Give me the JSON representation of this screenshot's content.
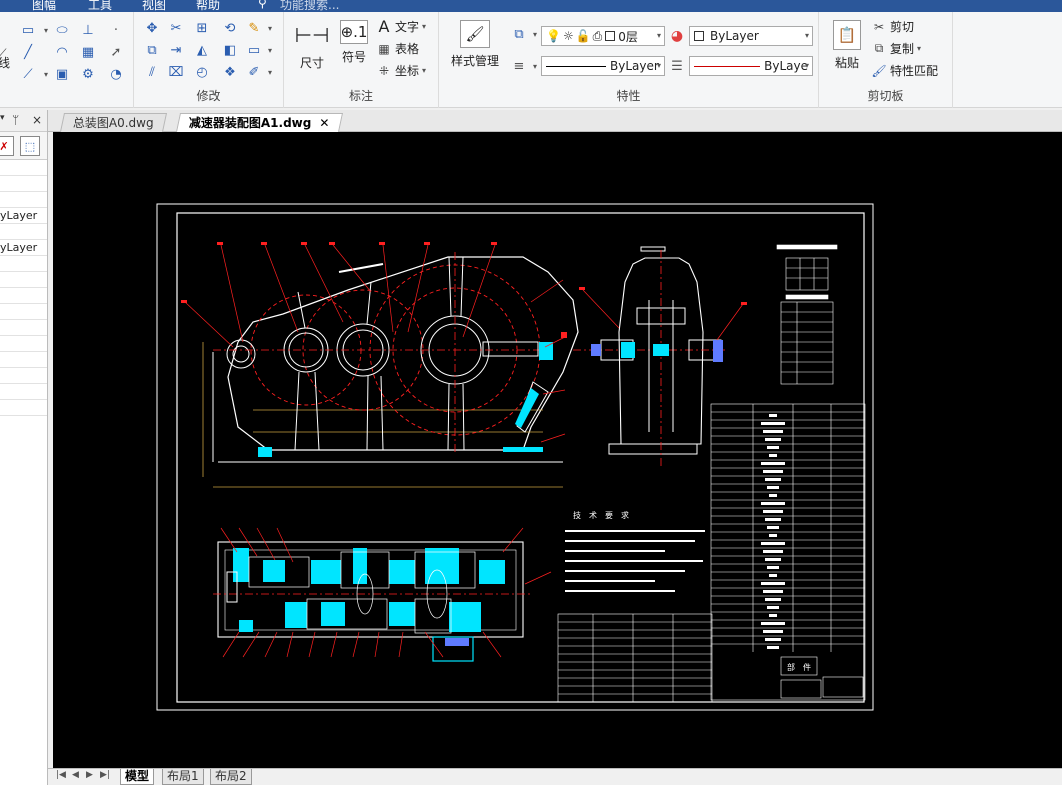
{
  "menu": {
    "items": [
      "图幅",
      "工具",
      "视图",
      "帮助"
    ],
    "search_placeholder": "功能搜索..."
  },
  "ribbon": {
    "draw_group": {
      "partial_label": "线"
    },
    "modify_group": {
      "label": "修改"
    },
    "annotate_group": {
      "label": "标注",
      "dimension_label": "尺寸",
      "symbol_label": "符号",
      "text_label": "文字",
      "table_label": "表格",
      "coord_label": "坐标"
    },
    "properties_group": {
      "label": "特性",
      "style_manager_label": "样式管理",
      "layer_value": "0层",
      "color_value": "ByLayer",
      "linetype_value": "ByLayer",
      "lineweight_value": "ByLaye"
    },
    "clipboard_group": {
      "label": "剪切板",
      "paste_label": "粘贴",
      "cut_label": "剪切",
      "copy_label": "复制",
      "match_label": "特性匹配"
    }
  },
  "left_panel": {
    "header_icons": [
      "▾",
      "ᛘ",
      "×"
    ],
    "rows": [
      "",
      "",
      "",
      "yLayer",
      "",
      "yLayer",
      "",
      "",
      "",
      "",
      "",
      "",
      "",
      "",
      "",
      ""
    ]
  },
  "tabs": [
    {
      "label": "总装图A0.dwg",
      "active": false
    },
    {
      "label": "减速器装配图A1.dwg",
      "active": true
    }
  ],
  "drawing": {
    "tech_req_title": "技　术　要　求",
    "parts_label": "部　件"
  },
  "layout_tabs": [
    {
      "label": "模型",
      "active": true
    },
    {
      "label": "布局1",
      "active": false
    },
    {
      "label": "布局2",
      "active": false
    }
  ],
  "colors": {
    "cad_background": "#000000",
    "accent_blue": "#2b579a",
    "cyan": "#00e5ff",
    "red_line": "#ff2020"
  }
}
